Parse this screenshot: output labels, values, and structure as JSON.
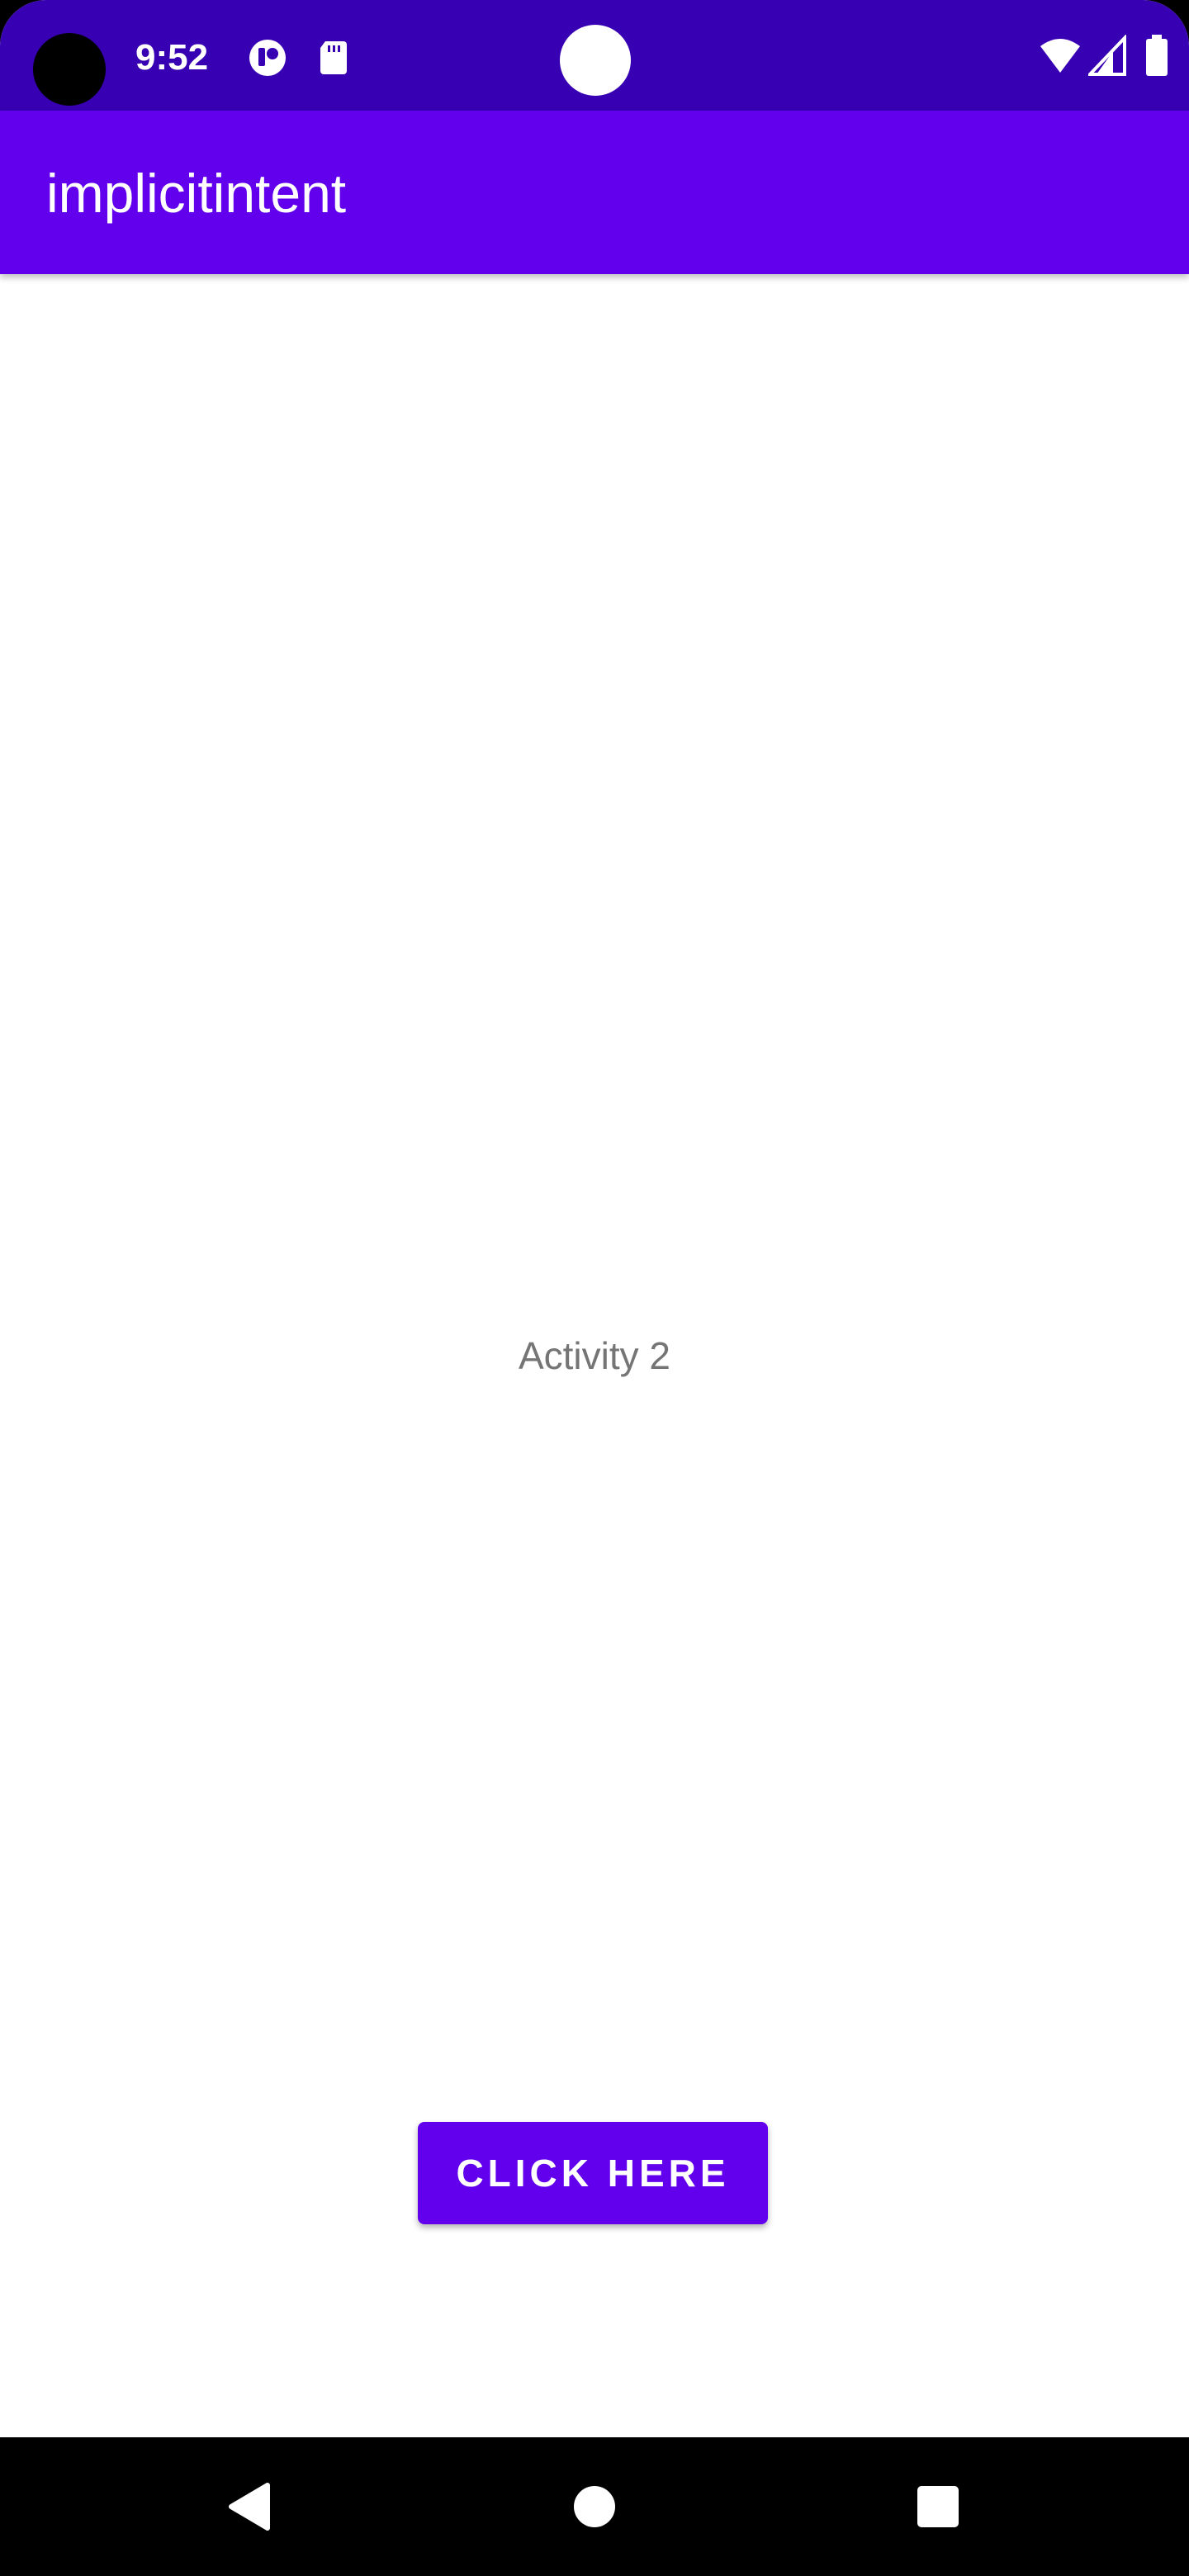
{
  "status_bar": {
    "time": "9:52",
    "background": "#3700b3",
    "icons": [
      "camera-hole",
      "notification-app-icon",
      "sd-card-icon",
      "wifi-icon",
      "cell-signal-icon",
      "battery-icon"
    ]
  },
  "app_bar": {
    "title": "implicitintent",
    "background": "#6200ee"
  },
  "main": {
    "label": "Activity 2",
    "button_label": "Click Here",
    "accent": "#6200ee"
  },
  "nav_bar": {
    "icons": [
      "back-icon",
      "home-icon",
      "recents-icon"
    ]
  }
}
